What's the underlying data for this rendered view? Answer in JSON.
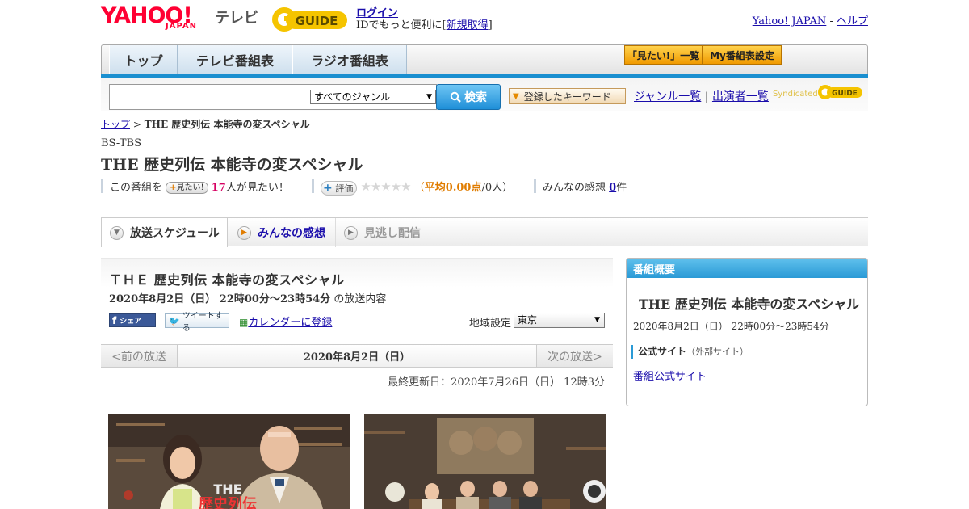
{
  "header": {
    "logo_yahoo": "YAHOO!",
    "logo_japan": "JAPAN",
    "logo_tv": "テレビ",
    "logo_gguide": "GUIDE",
    "login": "ログイン",
    "id_prefix": "IDでもっと便利に[",
    "id_signup": "新規取得",
    "id_suffix": "]",
    "yahoo_japan": "Yahoo! JAPAN",
    "separator": " - ",
    "help": "ヘルプ"
  },
  "nav": {
    "tabs": [
      "トップ",
      "テレビ番組表",
      "ラジオ番組表"
    ],
    "mitai_list": "「見たい!」一覧",
    "my_schedule": "My番組表設定"
  },
  "search": {
    "genre_selected": "すべてのジャンル",
    "search_button": "検索",
    "keyword_button": "登録したキーワード",
    "genre_list": "ジャンル一覧",
    "divider": "|",
    "performer_list": "出演者一覧",
    "syndicated": "Syndicated"
  },
  "breadcrumb": {
    "top": "トップ",
    "sep": " > ",
    "current": "THE 歴史列伝 本能寺の変スペシャル"
  },
  "program": {
    "station": "BS-TBS",
    "title": "THE 歴史列伝 本能寺の変スペシャル",
    "mitai_prefix": "この番組を",
    "mitai_button": "見たい!",
    "mitai_count": "17",
    "mitai_suffix": "人が見たい！",
    "hyoka_button": "評価",
    "stars": "★★★★★",
    "rating_open": "（",
    "rating_label": "平均",
    "rating_value": "0.00点",
    "rating_people": "/0人）",
    "impressions_label": "みんなの感想",
    "impressions_count": "0",
    "impressions_unit": "件"
  },
  "tabs": {
    "schedule": "放送スケジュール",
    "impressions": "みんなの感想",
    "missed": "見逃し配信"
  },
  "broadcast": {
    "title": "ＴＨＥ 歴史列伝 本能寺の変スペシャル",
    "datetime": "2020年8月2日（日） 22時00分～23時54分",
    "content_suffix": "の放送内容",
    "share_fb": "シェア",
    "share_tw": "ツイートする",
    "calendar": "カレンダーに登録",
    "region_label": "地域設定",
    "region_value": "東京",
    "prev": "<前の放送",
    "date": "2020年8月2日（日）",
    "next": "次の放送>",
    "updated": "最終更新日：2020年7月26日（日） 12時3分"
  },
  "sidebar": {
    "heading": "番組概要",
    "title": "THE 歴史列伝 本能寺の変スペシャル",
    "datetime": "2020年8月2日（日） 22時00分～23時54分",
    "official_label": "公式サイト",
    "official_note": "（外部サイト）",
    "official_link": "番組公式サイト"
  },
  "photo": {
    "logo_the": "THE",
    "logo_rest": "歴史列伝"
  },
  "colors": {
    "yahoo_red": "#ff0033",
    "nav_blue": "#1a8fd0",
    "side_blue": "#2a9ad6",
    "rating_orange": "#e07c00",
    "mitai_pink": "#d60062"
  }
}
